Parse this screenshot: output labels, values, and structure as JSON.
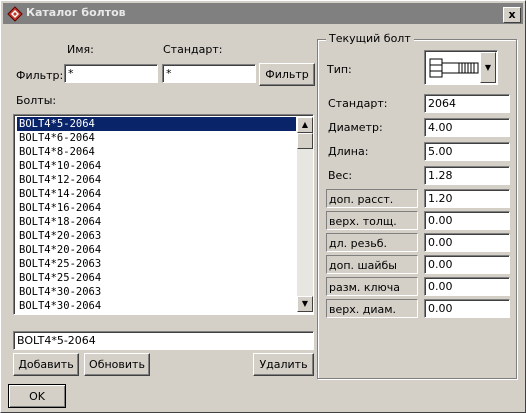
{
  "window": {
    "title": "Каталог болтов",
    "close_label": "x"
  },
  "filter": {
    "name_header": "Имя:",
    "standard_header": "Стандарт:",
    "label": "Фильтр:",
    "name_value": "*",
    "standard_value": "*",
    "button": "Фильтр"
  },
  "bolts": {
    "label": "Болты:",
    "items": [
      "BOLT4*5-2064",
      "BOLT4*6-2064",
      "BOLT4*8-2064",
      "BOLT4*10-2064",
      "BOLT4*12-2064",
      "BOLT4*14-2064",
      "BOLT4*16-2064",
      "BOLT4*18-2064",
      "BOLT4*20-2063",
      "BOLT4*20-2064",
      "BOLT4*25-2063",
      "BOLT4*25-2064",
      "BOLT4*30-2063",
      "BOLT4*30-2064"
    ],
    "selected_index": 0,
    "current_value": "BOLT4*5-2064"
  },
  "actions": {
    "add": "Добавить",
    "update": "Обновить",
    "delete": "Удалить"
  },
  "current": {
    "group_title": "Текущий болт",
    "type_label": "Тип:",
    "type_icon": "bolt-icon",
    "props": [
      {
        "label": "Стандарт:",
        "value": "2064",
        "framed": false
      },
      {
        "label": "Диаметр:",
        "value": "4.00",
        "framed": false
      },
      {
        "label": "Длина:",
        "value": "5.00",
        "framed": false
      },
      {
        "label": "Вес:",
        "value": "1.28",
        "framed": false
      },
      {
        "label": "доп. расст.",
        "value": "1.20",
        "framed": true
      },
      {
        "label": "верх. толщ.",
        "value": "0.00",
        "framed": true
      },
      {
        "label": "дл. резьб.",
        "value": "0.00",
        "framed": true
      },
      {
        "label": "доп. шайбы",
        "value": "0.00",
        "framed": true
      },
      {
        "label": "разм. ключа",
        "value": "0.00",
        "framed": true
      },
      {
        "label": "верх. диам.",
        "value": "0.00",
        "framed": true
      }
    ]
  },
  "ok_button": "OK",
  "colors": {
    "selection": "#0a246a",
    "face": "#d4d0c8",
    "inactive_title": "#808080"
  }
}
